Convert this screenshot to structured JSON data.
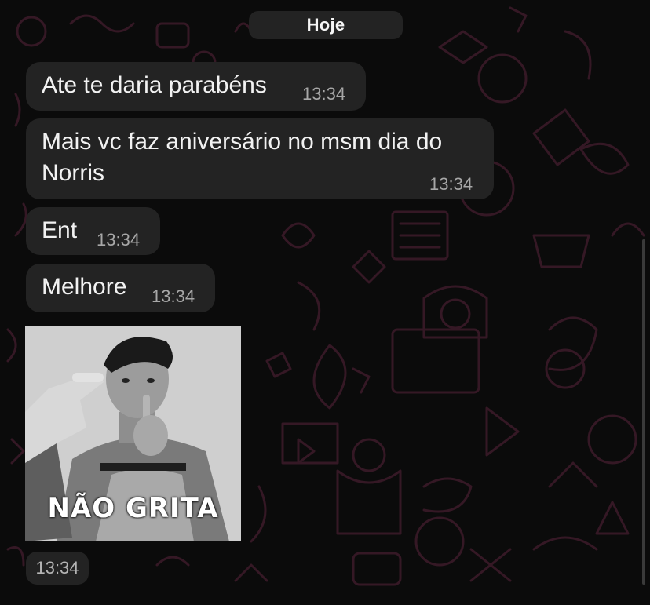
{
  "date_label": "Hoje",
  "messages": [
    {
      "text": "Ate te daria parabéns",
      "time": "13:34"
    },
    {
      "text": "Mais vc faz aniversário no msm dia do Norris",
      "time": "13:34"
    },
    {
      "text": "Ent",
      "time": "13:34"
    },
    {
      "text": "Melhore",
      "time": "13:34"
    }
  ],
  "sticker": {
    "caption": "NÃO GRITA",
    "time": "13:34"
  },
  "colors": {
    "background": "#0b0b0b",
    "bubble": "#232323",
    "wallpaper_pattern": "#3a1a28",
    "timestamp": "#a7a7a7"
  }
}
